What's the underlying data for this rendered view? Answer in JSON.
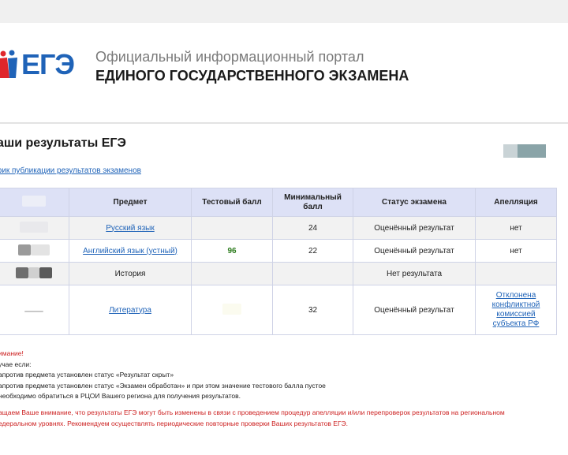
{
  "header": {
    "logo_text": "ЕГЭ",
    "portal_line1": "Официальный информационный портал",
    "portal_line2": "ЕДИНОГО ГОСУДАРСТВЕННОГО ЭКЗАМЕНА",
    "logo_colors": {
      "red": "#e0262c",
      "blue": "#1f63b8"
    }
  },
  "page": {
    "title": "аши результаты ЕГЭ",
    "schedule_link": "фик публикации результатов экзаменов"
  },
  "table": {
    "headers": [
      "Предмет",
      "Тестовый балл",
      "Минимальный балл",
      "Статус экзамена",
      "Апелляция"
    ],
    "rows": [
      {
        "subject": "Русский язык",
        "score": "",
        "min": "24",
        "status": "Оценённый результат",
        "appeal": "нет",
        "link": true
      },
      {
        "subject": "Английский язык (устный)",
        "score": "96",
        "min": "22",
        "status": "Оценённый результат",
        "appeal": "нет",
        "link": true
      },
      {
        "subject": "История",
        "score": "",
        "min": "",
        "status": "Нет результата",
        "appeal": "",
        "link": false
      },
      {
        "subject": "Литература",
        "score": "",
        "min": "32",
        "status": "Оценённый результат",
        "appeal": "Отклонена конфликтной комиссией субъекта РФ",
        "link": true
      }
    ]
  },
  "notes": {
    "attention": "имание!",
    "line1": "учае если:",
    "line2": "апротив предмета установлен статус «Результат скрыт»",
    "line3": "апротив предмета установлен статус «Экзамен обработан» и при этом значение тестового балла пустое",
    "line4": "необходимо обратиться в РЦОИ Вашего региона для получения результатов.",
    "bottom1": "ащаем Ваше внимание, что результаты ЕГЭ могут быть изменены в связи с проведением процедур апелляции и/или перепроверок результатов на региональном",
    "bottom2": "едеральном уровнях. Рекомендуем осуществлять периодические повторные проверки Ваших результатов ЕГЭ."
  }
}
